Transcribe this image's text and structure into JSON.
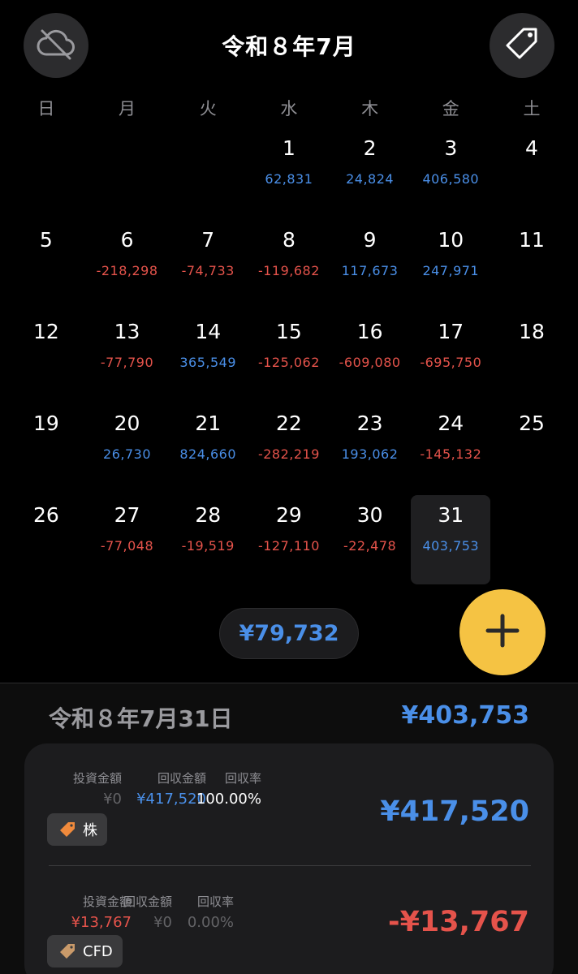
{
  "header": {
    "title": "令和８年7月",
    "left_icon": "cloud-off-icon",
    "right_icon": "tag-icon"
  },
  "weekdays": [
    "日",
    "月",
    "火",
    "水",
    "木",
    "金",
    "土"
  ],
  "calendar": {
    "weeks": [
      [
        {
          "day": "",
          "amount": "",
          "sign": ""
        },
        {
          "day": "",
          "amount": "",
          "sign": ""
        },
        {
          "day": "",
          "amount": "",
          "sign": ""
        },
        {
          "day": "1",
          "amount": "62,831",
          "sign": "pos"
        },
        {
          "day": "2",
          "amount": "24,824",
          "sign": "pos"
        },
        {
          "day": "3",
          "amount": "406,580",
          "sign": "pos"
        },
        {
          "day": "4",
          "amount": "",
          "sign": ""
        }
      ],
      [
        {
          "day": "5",
          "amount": "",
          "sign": ""
        },
        {
          "day": "6",
          "amount": "-218,298",
          "sign": "neg"
        },
        {
          "day": "7",
          "amount": "-74,733",
          "sign": "neg"
        },
        {
          "day": "8",
          "amount": "-119,682",
          "sign": "neg"
        },
        {
          "day": "9",
          "amount": "117,673",
          "sign": "pos"
        },
        {
          "day": "10",
          "amount": "247,971",
          "sign": "pos"
        },
        {
          "day": "11",
          "amount": "",
          "sign": ""
        }
      ],
      [
        {
          "day": "12",
          "amount": "",
          "sign": ""
        },
        {
          "day": "13",
          "amount": "-77,790",
          "sign": "neg"
        },
        {
          "day": "14",
          "amount": "365,549",
          "sign": "pos"
        },
        {
          "day": "15",
          "amount": "-125,062",
          "sign": "neg"
        },
        {
          "day": "16",
          "amount": "-609,080",
          "sign": "neg"
        },
        {
          "day": "17",
          "amount": "-695,750",
          "sign": "neg"
        },
        {
          "day": "18",
          "amount": "",
          "sign": ""
        }
      ],
      [
        {
          "day": "19",
          "amount": "",
          "sign": ""
        },
        {
          "day": "20",
          "amount": "26,730",
          "sign": "pos"
        },
        {
          "day": "21",
          "amount": "824,660",
          "sign": "pos"
        },
        {
          "day": "22",
          "amount": "-282,219",
          "sign": "neg"
        },
        {
          "day": "23",
          "amount": "193,062",
          "sign": "pos"
        },
        {
          "day": "24",
          "amount": "-145,132",
          "sign": "neg"
        },
        {
          "day": "25",
          "amount": "",
          "sign": ""
        }
      ],
      [
        {
          "day": "26",
          "amount": "",
          "sign": ""
        },
        {
          "day": "27",
          "amount": "-77,048",
          "sign": "neg"
        },
        {
          "day": "28",
          "amount": "-19,519",
          "sign": "neg"
        },
        {
          "day": "29",
          "amount": "-127,110",
          "sign": "neg"
        },
        {
          "day": "30",
          "amount": "-22,478",
          "sign": "neg"
        },
        {
          "day": "31",
          "amount": "403,753",
          "sign": "pos",
          "selected": true
        },
        {
          "day": "",
          "amount": "",
          "sign": ""
        }
      ]
    ]
  },
  "month_total": "¥79,732",
  "add_button_icon": "plus-icon",
  "detail": {
    "date": "令和８年7月31日",
    "total": "¥403,753",
    "entries": [
      {
        "labels": {
          "invest": "投資金額",
          "return": "回収金額",
          "rate": "回収率"
        },
        "invest": "¥0",
        "return": "¥417,520",
        "rate": "100.00%",
        "amount": "¥417,520",
        "tag": "株",
        "tag_icon": "tag-icon"
      },
      {
        "labels": {
          "invest": "投資金額",
          "return": "回収金額",
          "rate": "回収率"
        },
        "invest": "¥13,767",
        "return": "¥0",
        "rate": "0.00%",
        "amount": "-¥13,767",
        "tag": "CFD",
        "tag_icon": "tag-icon"
      }
    ]
  },
  "colors": {
    "positive": "#4a8fe8",
    "negative": "#e5534b",
    "accent": "#f5c343"
  }
}
